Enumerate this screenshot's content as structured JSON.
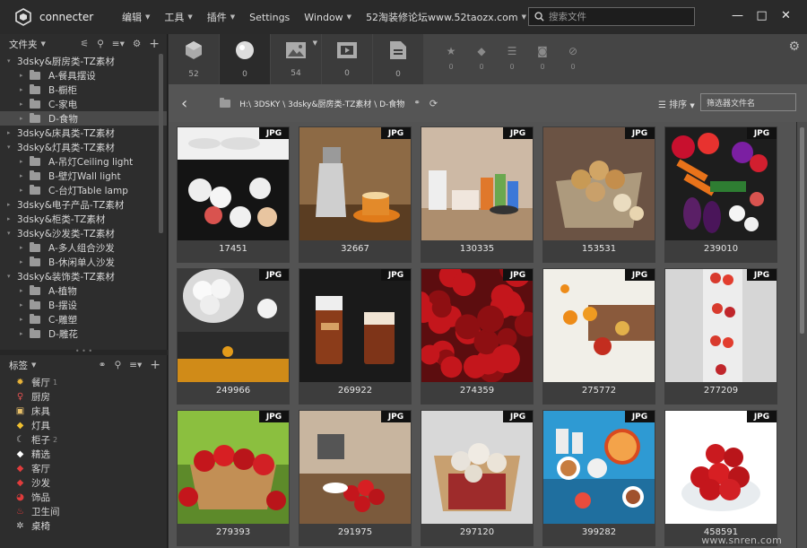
{
  "app": {
    "name": "connecter"
  },
  "menu": [
    {
      "label": "编辑",
      "caret": true
    },
    {
      "label": "工具",
      "caret": true
    },
    {
      "label": "插件",
      "caret": true
    },
    {
      "label": "Settings",
      "caret": false
    },
    {
      "label": "Window",
      "caret": true
    },
    {
      "label": "52淘装修论坛www.52taozx.com",
      "caret": true
    }
  ],
  "search": {
    "placeholder": "搜索文件"
  },
  "window": {
    "minimize": "—",
    "maximize": "□",
    "close": "✕"
  },
  "folders_panel": {
    "title": "文件夹"
  },
  "folders": [
    {
      "label": "3dsky&厨房类-TZ素材",
      "level": 0,
      "expanded": true
    },
    {
      "label": "A-餐具摆设",
      "level": 1
    },
    {
      "label": "B-橱柜",
      "level": 1
    },
    {
      "label": "C-家电",
      "level": 1
    },
    {
      "label": "D-食物",
      "level": 1,
      "selected": true
    },
    {
      "label": "3dsky&床具类-TZ素材",
      "level": 0
    },
    {
      "label": "3dsky&灯具类-TZ素材",
      "level": 0,
      "expanded": true
    },
    {
      "label": "A-吊灯Ceiling light",
      "level": 1
    },
    {
      "label": "B-壁灯Wall light",
      "level": 1
    },
    {
      "label": "C-台灯Table lamp",
      "level": 1
    },
    {
      "label": "3dsky&电子产品-TZ素材",
      "level": 0
    },
    {
      "label": "3dsky&柜类-TZ素材",
      "level": 0
    },
    {
      "label": "3dsky&沙发类-TZ素材",
      "level": 0,
      "expanded": true
    },
    {
      "label": "A-多人组合沙发",
      "level": 1
    },
    {
      "label": "B-休闲单人沙发",
      "level": 1
    },
    {
      "label": "3dsky&装饰类-TZ素材",
      "level": 0,
      "expanded": true
    },
    {
      "label": "A-植物",
      "level": 1
    },
    {
      "label": "B-摆设",
      "level": 1
    },
    {
      "label": "C-雕塑",
      "level": 1
    },
    {
      "label": "D-雕花",
      "level": 1
    }
  ],
  "tags_panel": {
    "title": "标签"
  },
  "tags": [
    {
      "label": "餐厅",
      "count": "1",
      "icon": "sun-icon",
      "color": "#e8b339",
      "glyph": "✹"
    },
    {
      "label": "厨房",
      "count": "",
      "icon": "bulb-icon",
      "color": "#e05050",
      "glyph": "♀"
    },
    {
      "label": "床具",
      "count": "",
      "icon": "image-icon",
      "color": "#e8c06a",
      "glyph": "▣"
    },
    {
      "label": "灯具",
      "count": "",
      "icon": "tag-icon",
      "color": "#f0c030",
      "glyph": "◆"
    },
    {
      "label": "柜子",
      "count": "2",
      "icon": "moon-icon",
      "color": "#cccccc",
      "glyph": "☾"
    },
    {
      "label": "精选",
      "count": "",
      "icon": "tag-icon",
      "color": "#ffffff",
      "glyph": "◆"
    },
    {
      "label": "客厅",
      "count": "",
      "icon": "tag-icon",
      "color": "#e03c3c",
      "glyph": "◆"
    },
    {
      "label": "沙发",
      "count": "",
      "icon": "tag-icon",
      "color": "#e03c3c",
      "glyph": "◆"
    },
    {
      "label": "饰品",
      "count": "",
      "icon": "pacman-icon",
      "color": "#e03c3c",
      "glyph": "◕"
    },
    {
      "label": "卫生间",
      "count": "",
      "icon": "toilet-icon",
      "color": "#e03c3c",
      "glyph": "♨"
    },
    {
      "label": "桌椅",
      "count": "",
      "icon": "bug-icon",
      "color": "#cccccc",
      "glyph": "✲"
    }
  ],
  "type_tabs": [
    {
      "name": "cube",
      "count": "52"
    },
    {
      "name": "sphere",
      "count": "0"
    },
    {
      "name": "image",
      "count": "54"
    },
    {
      "name": "video",
      "count": "0"
    },
    {
      "name": "document",
      "count": "0"
    }
  ],
  "filter_tabs": [
    {
      "name": "star",
      "count": "0"
    },
    {
      "name": "tag",
      "count": "0"
    },
    {
      "name": "list",
      "count": "0"
    },
    {
      "name": "camera",
      "count": "0"
    },
    {
      "name": "block",
      "count": "0"
    }
  ],
  "path": {
    "crumbs": "H:\\ 3DSKY \\ 3dsky&厨房类-TZ素材 \\ D-食物",
    "sort": "排序",
    "filter_placeholder": "筛选器文件名"
  },
  "grid": [
    {
      "label": "17451",
      "badge": "JPG",
      "theme": "eggs-dark"
    },
    {
      "label": "32667",
      "badge": "JPG",
      "theme": "coffee"
    },
    {
      "label": "130335",
      "badge": "JPG",
      "theme": "kitchen"
    },
    {
      "label": "153531",
      "badge": "JPG",
      "theme": "bread"
    },
    {
      "label": "239010",
      "badge": "JPG",
      "theme": "veggies"
    },
    {
      "label": "249966",
      "badge": "JPG",
      "theme": "eggs-wood"
    },
    {
      "label": "269922",
      "badge": "JPG",
      "theme": "latte"
    },
    {
      "label": "274359",
      "badge": "JPG",
      "theme": "apples-red"
    },
    {
      "label": "275772",
      "badge": "JPG",
      "theme": "oranges"
    },
    {
      "label": "277209",
      "badge": "JPG",
      "theme": "vertical-fruit"
    },
    {
      "label": "279393",
      "badge": "JPG",
      "theme": "basket-apples"
    },
    {
      "label": "291975",
      "badge": "JPG",
      "theme": "table-apples"
    },
    {
      "label": "297120",
      "badge": "JPG",
      "theme": "mushrooms"
    },
    {
      "label": "399282",
      "badge": "JPG",
      "theme": "breakfast"
    },
    {
      "label": "458591",
      "badge": "JPG",
      "theme": "glass-apples"
    }
  ],
  "watermark": "www.snren.com"
}
